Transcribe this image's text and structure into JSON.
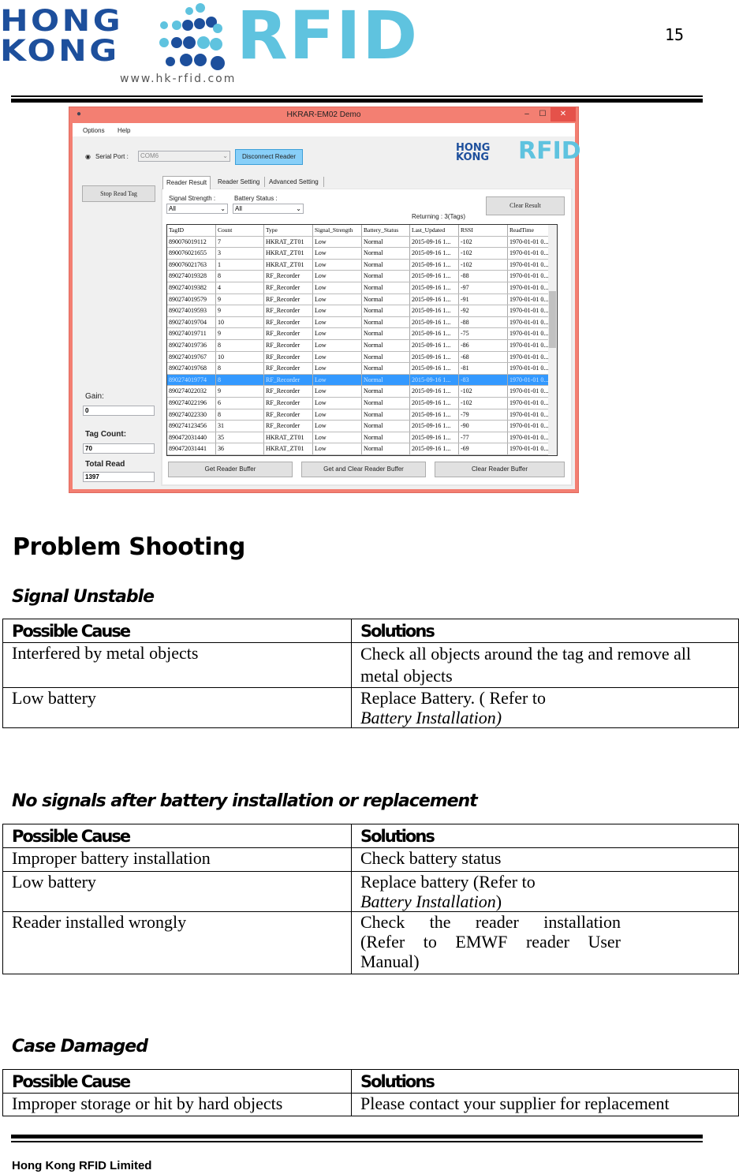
{
  "header": {
    "logo_line1": "HONG",
    "logo_line2": "KONG",
    "logo_rfid": "RFID",
    "logo_url": "www.hk-rfid.com",
    "page_number": "15"
  },
  "app": {
    "title": "HKRAR-EM02 Demo",
    "menu": [
      "Options",
      "Help"
    ],
    "serial_port_label": "Serial Port :",
    "serial_port_value": "COM6",
    "disconnect_label": "Disconnect Reader",
    "stop_read_label": "Stop Read Tag",
    "tabs": [
      "Reader Result",
      "Reader Setting",
      "Advanced Setting"
    ],
    "signal_strength_label": "Signal Strength :",
    "signal_strength_value": "All",
    "battery_status_label": "Battery Status :",
    "battery_status_value": "All",
    "returning": "Returning : 3(Tags)",
    "clear_result_label": "Clear Result",
    "gain_label": "Gain:",
    "gain_value": "0",
    "tag_count_label": "Tag Count:",
    "tag_count_value": "70",
    "total_read_label": "Total  Read",
    "total_read_value": "1397",
    "columns": [
      "TagID",
      "Count",
      "Type",
      "Signal_Strength",
      "Battery_Status",
      "Last_Updated",
      "RSSI",
      "ReadTime"
    ],
    "rows": [
      [
        "890076019112",
        "7",
        "HKRAT_ZT01",
        "Low",
        "Normal",
        "2015-09-16 1...",
        "-102",
        "1970-01-01 0..."
      ],
      [
        "890076021655",
        "3",
        "HKRAT_ZT01",
        "Low",
        "Normal",
        "2015-09-16 1...",
        "-102",
        "1970-01-01 0..."
      ],
      [
        "890076021763",
        "1",
        "HKRAT_ZT01",
        "Low",
        "Normal",
        "2015-09-16 1...",
        "-102",
        "1970-01-01 0..."
      ],
      [
        "890274019328",
        "8",
        "RF_Recorder",
        "Low",
        "Normal",
        "2015-09-16 1...",
        "-88",
        "1970-01-01 0..."
      ],
      [
        "890274019382",
        "4",
        "RF_Recorder",
        "Low",
        "Normal",
        "2015-09-16 1...",
        "-97",
        "1970-01-01 0..."
      ],
      [
        "890274019579",
        "9",
        "RF_Recorder",
        "Low",
        "Normal",
        "2015-09-16 1...",
        "-91",
        "1970-01-01 0..."
      ],
      [
        "890274019593",
        "9",
        "RF_Recorder",
        "Low",
        "Normal",
        "2015-09-16 1...",
        "-92",
        "1970-01-01 0..."
      ],
      [
        "890274019704",
        "10",
        "RF_Recorder",
        "Low",
        "Normal",
        "2015-09-16 1...",
        "-88",
        "1970-01-01 0..."
      ],
      [
        "890274019711",
        "9",
        "RF_Recorder",
        "Low",
        "Normal",
        "2015-09-16 1...",
        "-75",
        "1970-01-01 0..."
      ],
      [
        "890274019736",
        "8",
        "RF_Recorder",
        "Low",
        "Normal",
        "2015-09-16 1...",
        "-86",
        "1970-01-01 0..."
      ],
      [
        "890274019767",
        "10",
        "RF_Recorder",
        "Low",
        "Normal",
        "2015-09-16 1...",
        "-68",
        "1970-01-01 0..."
      ],
      [
        "890274019768",
        "8",
        "RF_Recorder",
        "Low",
        "Normal",
        "2015-09-16 1...",
        "-81",
        "1970-01-01 0..."
      ],
      [
        "890274019774",
        "8",
        "RF_Recorder",
        "Low",
        "Normal",
        "2015-09-16 1...",
        "-83",
        "1970-01-01 0..."
      ],
      [
        "890274022032",
        "9",
        "RF_Recorder",
        "Low",
        "Normal",
        "2015-09-16 1...",
        "-102",
        "1970-01-01 0..."
      ],
      [
        "890274022196",
        "6",
        "RF_Recorder",
        "Low",
        "Normal",
        "2015-09-16 1...",
        "-102",
        "1970-01-01 0..."
      ],
      [
        "890274022330",
        "8",
        "RF_Recorder",
        "Low",
        "Normal",
        "2015-09-16 1...",
        "-79",
        "1970-01-01 0..."
      ],
      [
        "890274123456",
        "31",
        "RF_Recorder",
        "Low",
        "Normal",
        "2015-09-16 1...",
        "-90",
        "1970-01-01 0..."
      ],
      [
        "890472031440",
        "35",
        "HKRAT_ZT01",
        "Low",
        "Normal",
        "2015-09-16 1...",
        "-77",
        "1970-01-01 0..."
      ],
      [
        "890472031441",
        "36",
        "HKRAT_ZT01",
        "Low",
        "Normal",
        "2015-09-16 1...",
        "-69",
        "1970-01-01 0..."
      ]
    ],
    "selected_row": 12,
    "buttons": [
      "Get Reader Buffer",
      "Get and Clear Reader Buffer",
      "Clear Reader Buffer"
    ],
    "colors": {
      "titlebar": "#f37f72",
      "selection": "#3399ff",
      "disconnect": "#88cff8"
    }
  },
  "doc": {
    "title": "Problem Shooting",
    "col_cause": "Possible Cause",
    "col_solution": "Solutions",
    "sections": [
      {
        "heading": "Signal Unstable",
        "rows": [
          {
            "cause": "Interfered by metal objects",
            "solution": "Check all objects around the tag and remove all metal objects"
          },
          {
            "cause": "Low battery",
            "solution": "Replace Battery. ( Refer to",
            "solution_italic": "Battery Installation)"
          }
        ]
      },
      {
        "heading": "No signals after battery installation or replacement",
        "rows": [
          {
            "cause": "Improper battery installation",
            "solution": "Check battery status"
          },
          {
            "cause": "Low battery",
            "solution": "Replace battery (Refer to",
            "solution_italic": "Battery Installation",
            "solution_tail": ")"
          },
          {
            "cause": "Reader installed wrongly",
            "solution": "Check the reader installation (Refer to EMWF reader User Manual)"
          }
        ]
      },
      {
        "heading": "Case Damaged",
        "rows": [
          {
            "cause": "Improper storage or hit by hard objects",
            "solution": "Please contact your supplier for replacement"
          }
        ]
      }
    ]
  },
  "footer": {
    "company": "Hong Kong RFID Limited"
  }
}
